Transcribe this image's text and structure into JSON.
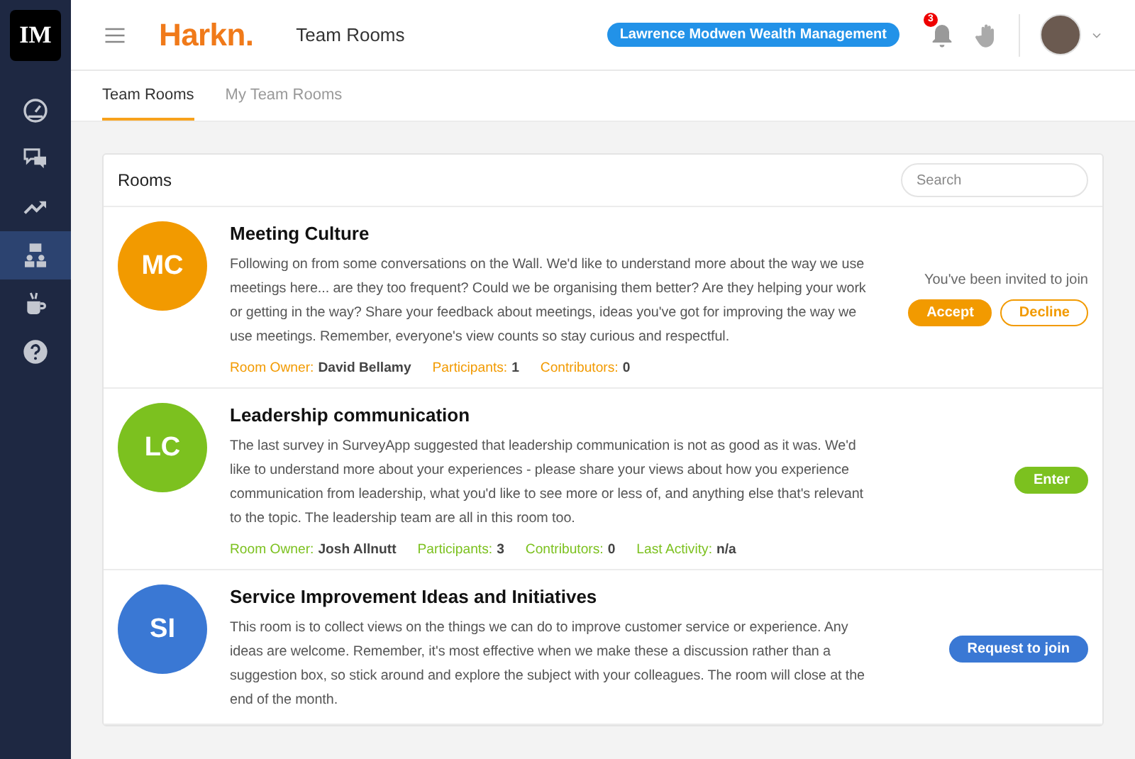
{
  "sidebar": {
    "logo": "IM",
    "items": [
      {
        "kind": "gauge",
        "selected": false
      },
      {
        "kind": "chat",
        "selected": false
      },
      {
        "kind": "trend",
        "selected": false
      },
      {
        "kind": "org",
        "selected": true
      },
      {
        "kind": "cup",
        "selected": false
      },
      {
        "kind": "help",
        "selected": false
      }
    ]
  },
  "header": {
    "brand": "Harkn",
    "brand_dot": ".",
    "title": "Team Rooms",
    "org_badge": "Lawrence Modwen Wealth Management",
    "notification_count": "3"
  },
  "tabs": [
    {
      "label": "Team Rooms",
      "selected": true
    },
    {
      "label": "My Team Rooms",
      "selected": false
    }
  ],
  "panel": {
    "title": "Rooms",
    "search": {
      "placeholder": "Search"
    },
    "rooms": [
      {
        "initials": "MC",
        "color": "#f29a00",
        "title": "Meeting Culture",
        "description": "Following on from some conversations on the Wall. We'd like to understand more about the way we use meetings here... are they too frequent? Could we be organising them better? Are they helping your work or getting in the way? Share your feedback about meetings, ideas you've got for improving the way we use meetings. Remember, everyone's view counts so stay curious and respectful.",
        "meta": [
          {
            "label": "Room Owner:",
            "value": "David Bellamy"
          },
          {
            "label": "Participants:",
            "value": "1"
          },
          {
            "label": "Contributors:",
            "value": "0"
          }
        ],
        "action": {
          "note": "You've been invited to join",
          "buttons": [
            {
              "label": "Accept",
              "kind": "filled"
            },
            {
              "label": "Decline",
              "kind": "outline"
            }
          ]
        }
      },
      {
        "initials": "LC",
        "color": "#7cc11f",
        "title": "Leadership communication",
        "description": "The last survey in SurveyApp suggested that leadership communication is not as good as it was. We'd like to understand more about your experiences - please share your views about how you experience communication from leadership, what you'd like to see more or less of, and anything else that's relevant to the topic. The leadership team are all in this room too.",
        "meta": [
          {
            "label": "Room Owner:",
            "value": "Josh Allnutt"
          },
          {
            "label": "Participants:",
            "value": "3"
          },
          {
            "label": "Contributors:",
            "value": "0"
          },
          {
            "label": "Last Activity:",
            "value": "n/a"
          }
        ],
        "action": {
          "buttons": [
            {
              "label": "Enter",
              "kind": "filled"
            }
          ]
        }
      },
      {
        "initials": "SI",
        "color": "#3a78d4",
        "title": "Service Improvement Ideas and Initiatives",
        "description": "This room is to collect views on the things we can do to improve customer service or experience. Any ideas are welcome. Remember, it's most effective when we make these a discussion rather than a suggestion box, so stick around and explore the subject with your colleagues. The room will close at the end of the month.",
        "action": {
          "buttons": [
            {
              "label": "Request to join",
              "kind": "filled"
            }
          ]
        }
      }
    ]
  }
}
